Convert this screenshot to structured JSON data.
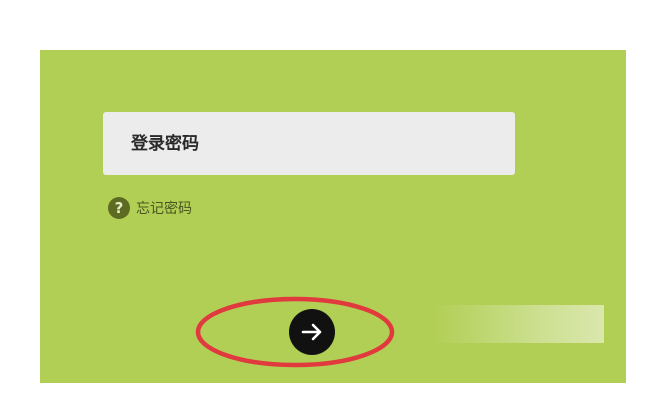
{
  "login": {
    "password_placeholder": "登录密码",
    "forgot_password_label": "忘记密码",
    "help_icon_glyph": "?",
    "submit_icon": "arrow-right-icon"
  },
  "colors": {
    "panel_background": "#b2cf55",
    "input_background": "#ececec",
    "button_background": "#111111",
    "annotation_stroke": "#e0393e"
  }
}
